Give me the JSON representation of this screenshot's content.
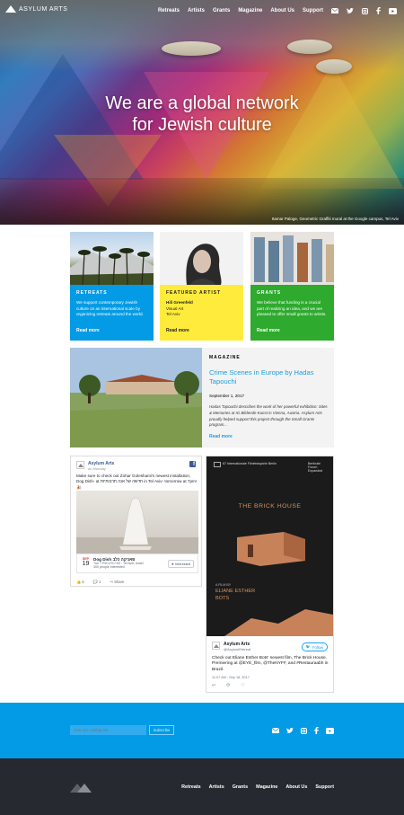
{
  "header": {
    "logo_text": "ASYLUM ARTS",
    "nav": [
      "Retreats",
      "Artists",
      "Grants",
      "Magazine",
      "About Us",
      "Support"
    ],
    "social_icons": [
      "email-icon",
      "twitter-icon",
      "instagram-icon",
      "facebook-icon",
      "youtube-icon"
    ]
  },
  "hero": {
    "title_line1": "We are a global network",
    "title_line2": "for Jewish culture",
    "caption": "Itamar Paloge, Geometric Graffiti mural at the Google campus, Tel Aviv"
  },
  "cards": [
    {
      "label": "RETREATS",
      "body": "We support contemporary Jewish culture on an international scale by organizing retreats around the world.",
      "more": "Read more",
      "color": "#039be5",
      "text_color": "#ffffff"
    },
    {
      "label": "FEATURED ARTIST",
      "line1": "Hili Greenfeld",
      "line2": "Visual Art",
      "line3": "Tel Aviv",
      "more": "Read more",
      "color": "#ffeb3b",
      "text_color": "#222222"
    },
    {
      "label": "GRANTS",
      "body": "We believe that funding is a crucial part of realizing an idea, and we are pleased to offer small grants to artists.",
      "more": "Read more",
      "color": "#2eaa2e",
      "text_color": "#ffffff"
    }
  ],
  "magazine": {
    "label": "MAGAZINE",
    "title": "Crime Scenes in Europe by Hadas Tapouchi",
    "date": "September 1, 2017",
    "desc": "Hadas Tapouchi describes the work of her powerful exhibition: Sites & Memories at IG Bildende Kunst in Vienna, Austria. Asylum Arts proudly helped support this project through the Small Grants program...",
    "more": "Read more"
  },
  "facebook": {
    "name": "Asylum Arts",
    "when": "on Monday",
    "text": "Make sure to check out Zohar Goleshami's newest installation, Dog Dish- at ‏חדשה ‏של אנה ‏תרבותיות in Tel Aviv- tomorrow at 7pm! 🎉",
    "event_month": "SEP",
    "event_day": "19",
    "event_title": "Dog Dish ‏פאניקה ‏כלב",
    "event_when": "Tue 7 PM UTC+03 · Tel Aviv, Israel",
    "event_count": "300 people interested",
    "interested": "★ Interested",
    "likes": "5",
    "comments": "1",
    "share": "Share"
  },
  "twitter": {
    "poster_badge": "67 Internationale Filmfestspiele Berlin",
    "poster_corner": "Berlinale Forum Expanded",
    "poster_title": "THE BRICK HOUSE",
    "poster_credit1": "A FILM BY",
    "poster_credit2": "ELIANE ESTHER",
    "poster_credit3": "BOTS",
    "name": "Asylum Arts",
    "handle": "@AsylumRetreat",
    "follow": "Follow",
    "text": "Check out Eliane Esther Bots' newest film, The Brick House. Premiering at @EYE_film, @TheNYFF, and #Restauraabh in Brazil.",
    "time": "11:07 AM - Sep 18, 2017"
  },
  "newsletter": {
    "placeholder": "Join our mailing list",
    "button": "Subscribe"
  },
  "footer_nav": [
    "Retreats",
    "Artists",
    "Grants",
    "Magazine",
    "About Us",
    "Support"
  ]
}
